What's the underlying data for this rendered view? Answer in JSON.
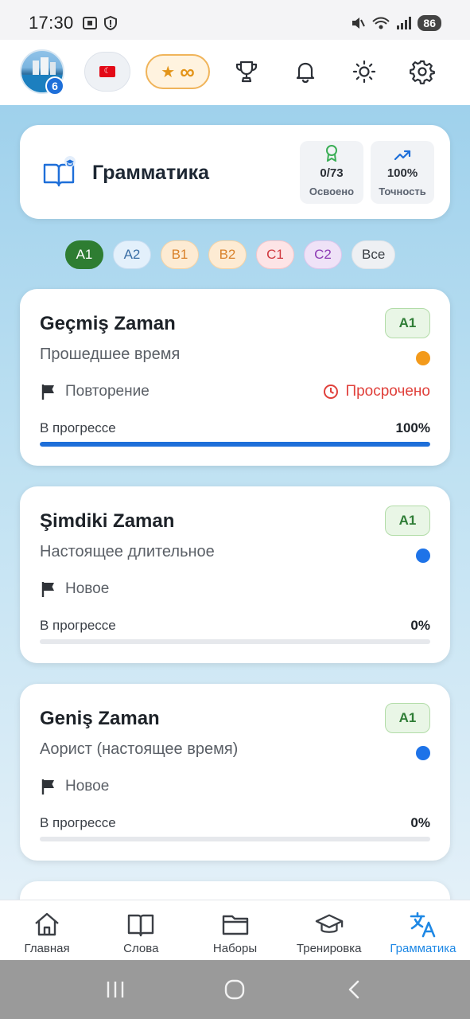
{
  "status_bar": {
    "time": "17:30",
    "battery": "86"
  },
  "app_bar": {
    "avatar_badge": "6",
    "flag_emoji": "☾",
    "premium_star": "★",
    "premium_infinity": "∞"
  },
  "header": {
    "title": "Грамматика",
    "stats": [
      {
        "value": "0/73",
        "label": "Освоено",
        "icon": "award-icon"
      },
      {
        "value": "100%",
        "label": "Точность",
        "icon": "trending-up-icon"
      }
    ]
  },
  "levels": [
    {
      "label": "A1",
      "bg": "#2e7d32",
      "fg": "#ffffff",
      "border": "#2e7d32"
    },
    {
      "label": "A2",
      "bg": "#e3f0fb",
      "fg": "#3a6ea5",
      "border": "#c7ddf1"
    },
    {
      "label": "B1",
      "bg": "#fdebd3",
      "fg": "#d9822b",
      "border": "#f5d3a6"
    },
    {
      "label": "B2",
      "bg": "#fdebd3",
      "fg": "#d9822b",
      "border": "#f5d3a6"
    },
    {
      "label": "C1",
      "bg": "#fde4e6",
      "fg": "#d0393f",
      "border": "#f5c6ca"
    },
    {
      "label": "C2",
      "bg": "#efe2f7",
      "fg": "#8e3bb5",
      "border": "#dcc6ec"
    },
    {
      "label": "Все",
      "bg": "#eef0f3",
      "fg": "#3b3f45",
      "border": "#e0e3e8"
    }
  ],
  "topics": [
    {
      "title": "Geçmiş Zaman",
      "subtitle": "Прошедшее время",
      "level": "A1",
      "dot_color": "#f39a1b",
      "status": "Повторение",
      "overdue": "Просрочено",
      "progress_label": "В прогрессе",
      "progress_text": "100%",
      "progress": 1.0
    },
    {
      "title": "Şimdiki Zaman",
      "subtitle": "Настоящее длительное",
      "level": "A1",
      "dot_color": "#1e73e8",
      "status": "Новое",
      "progress_label": "В прогрессе",
      "progress_text": "0%",
      "progress": 0.0
    },
    {
      "title": "Geniş Zaman",
      "subtitle": "Аорист (настоящее время)",
      "level": "A1",
      "dot_color": "#1e73e8",
      "status": "Новое",
      "progress_label": "В прогрессе",
      "progress_text": "0%",
      "progress": 0.0
    }
  ],
  "bottom_nav": [
    {
      "label": "Главная",
      "icon": "home-icon"
    },
    {
      "label": "Слова",
      "icon": "book-icon"
    },
    {
      "label": "Наборы",
      "icon": "folder-icon"
    },
    {
      "label": "Тренировка",
      "icon": "graduation-cap-icon"
    },
    {
      "label": "Грамматика",
      "icon": "translate-icon",
      "active": true
    }
  ],
  "colors": {
    "accent": "#1e6fd9",
    "active_nav": "#1e88e5",
    "overdue": "#e0403b"
  }
}
